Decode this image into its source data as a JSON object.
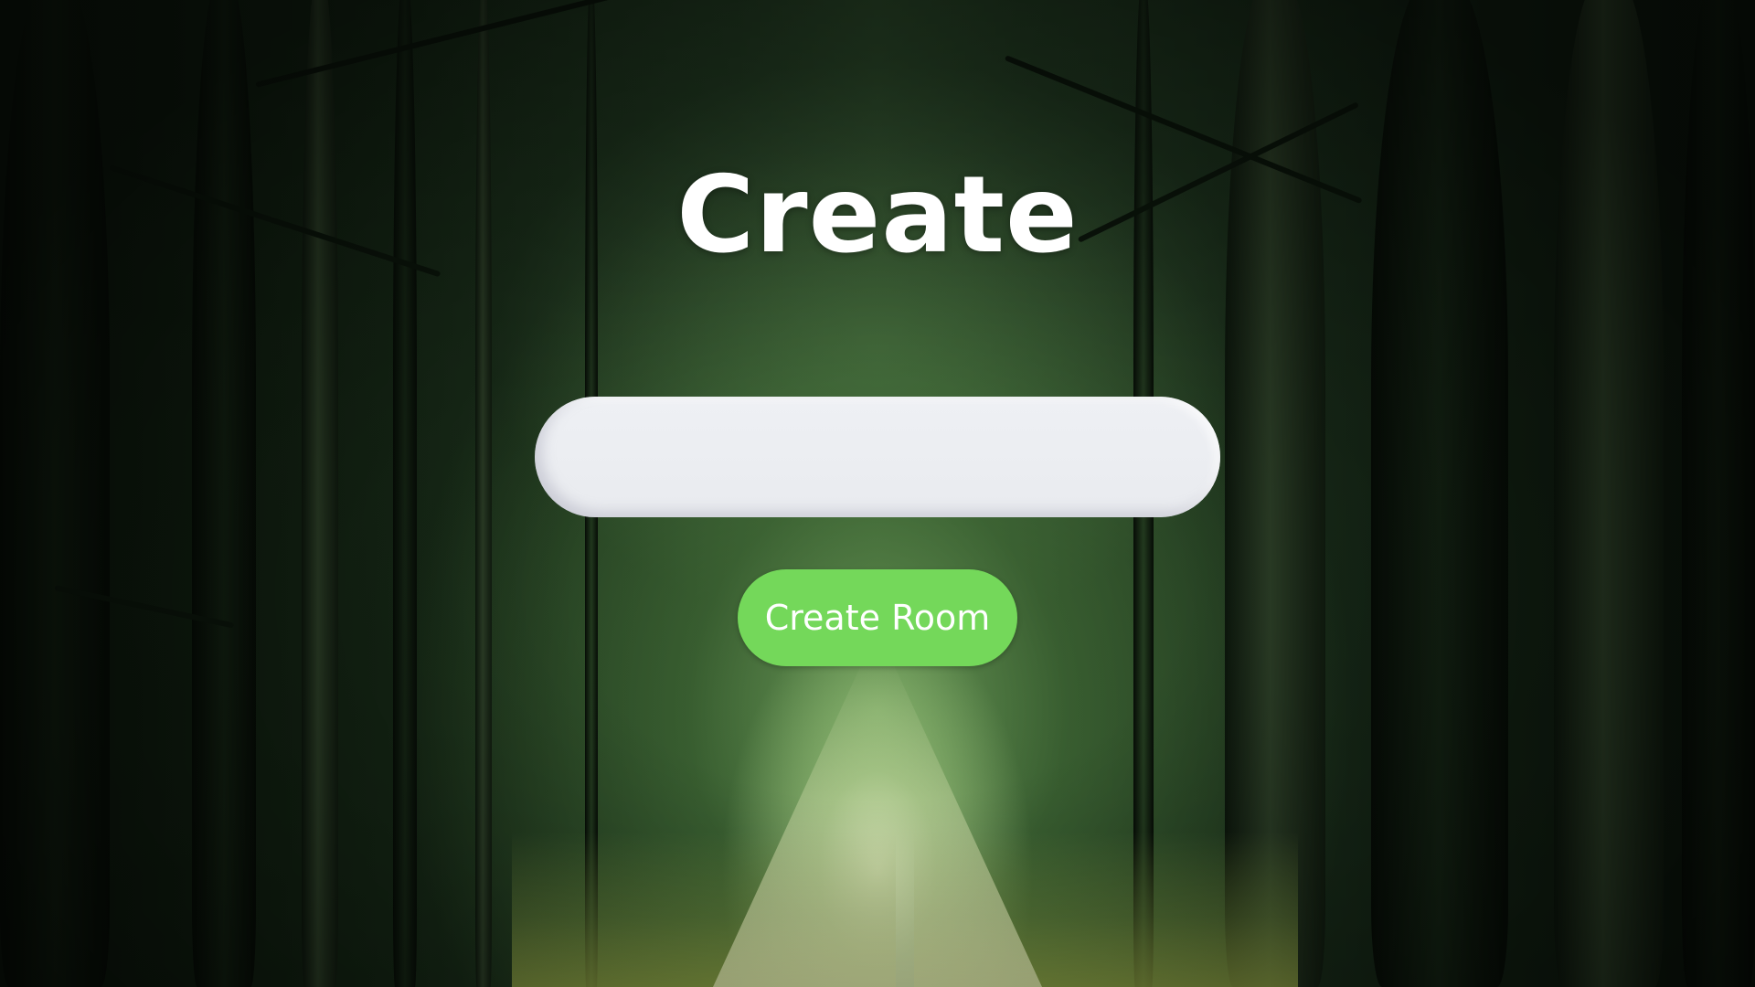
{
  "page": {
    "title": "Create"
  },
  "room_form": {
    "name_input_value": "",
    "name_input_placeholder": "",
    "create_button_label": "Create Room"
  },
  "theme": {
    "button_color": "#74d85a",
    "input_color": "#eceef2",
    "title_color": "#ffffff",
    "background": "dark-forest-path-photo"
  }
}
